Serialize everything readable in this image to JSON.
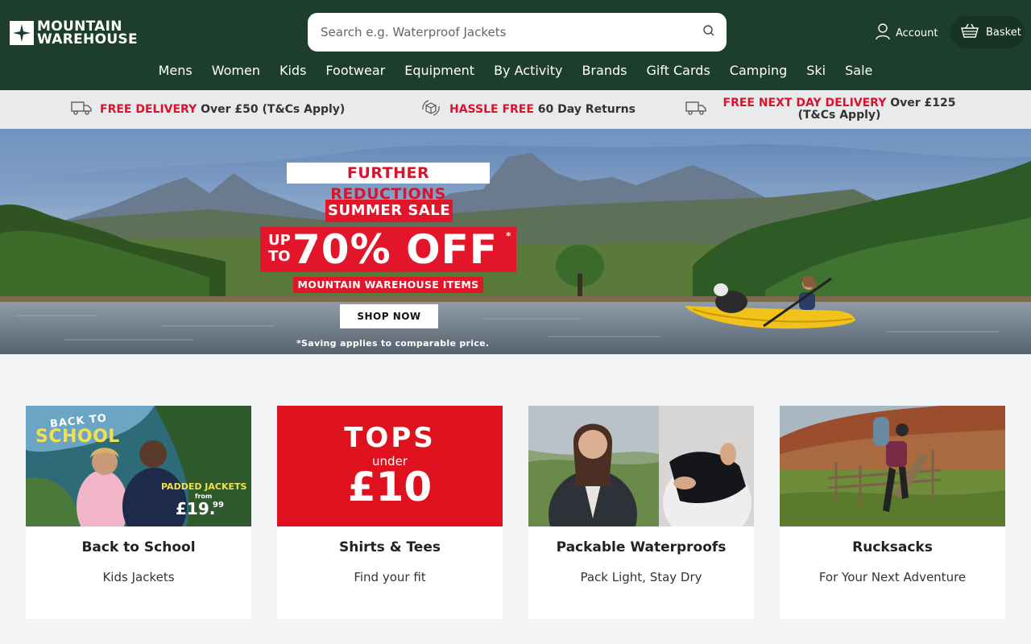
{
  "brand": {
    "line1": "MOUNTAIN",
    "line2": "WAREHOUSE"
  },
  "search": {
    "placeholder": "Search e.g. Waterproof Jackets"
  },
  "header": {
    "account_label": "Account",
    "basket_label": "Basket"
  },
  "nav": [
    "Mens",
    "Women",
    "Kids",
    "Footwear",
    "Equipment",
    "By Activity",
    "Brands",
    "Gift Cards",
    "Camping",
    "Ski",
    "Sale"
  ],
  "usp": [
    {
      "highlight": "FREE DELIVERY",
      "text": " Over £50 (T&Cs Apply)",
      "icon": "truck-icon"
    },
    {
      "highlight": "HASSLE FREE",
      "text": " 60 Day Returns",
      "icon": "returns-icon"
    },
    {
      "highlight": "FREE NEXT DAY DELIVERY",
      "text": " Over £125 (T&Cs Apply)",
      "icon": "truck-icon"
    }
  ],
  "hero": {
    "kicker": "FURTHER REDUCTIONS",
    "sale": "SUMMER SALE",
    "up": "UP",
    "to": "TO",
    "discount": "70% OFF",
    "asterisk": "*",
    "items": "MOUNTAIN WAREHOUSE ITEMS",
    "cta": "SHOP NOW",
    "disclaimer": "*Saving applies to comparable price."
  },
  "cards": [
    {
      "title": "Back to School",
      "subtitle": "Kids Jackets",
      "img_text": {
        "a": "BACK TO",
        "b": "SCHOOL",
        "c": "PADDED JACKETS",
        "d": "from",
        "e": "£19.",
        "f": "99"
      }
    },
    {
      "title": "Shirts & Tees",
      "subtitle": "Find your fit",
      "img_text": {
        "a": "TOPS",
        "b": "under",
        "c": "£10"
      }
    },
    {
      "title": "Packable Waterproofs",
      "subtitle": "Pack Light, Stay Dry"
    },
    {
      "title": "Rucksacks",
      "subtitle": "For Your Next Adventure"
    }
  ],
  "colors": {
    "header_bg": "#1d3d2d",
    "accent_red": "#d9132b",
    "usp_bg": "#e8eaec",
    "page_bg": "#f3f4f6"
  }
}
